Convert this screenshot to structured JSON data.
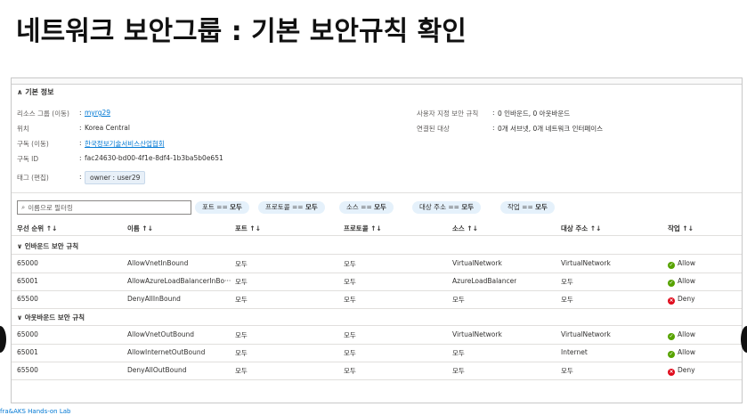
{
  "slide": {
    "title": "네트워크 보안그룹 : 기본 보안규칙 확인",
    "footer": "fra&AKS Hands-on Lab"
  },
  "essentials": {
    "header": "∧ 기본 정보",
    "resource_group_label": "리소스 그룹 (이동)",
    "resource_group_value": "myrg29",
    "location_label": "위치",
    "location_value": "Korea Central",
    "subscription_label": "구독 (이동)",
    "subscription_value": "한국정보기술서비스산업협회",
    "subscription_id_label": "구독 ID",
    "subscription_id_value": "fac24630-bd00-4f1e-8df4-1b3ba5b0e651",
    "tags_label": "태그 (편집)",
    "tag_value": "owner : user29",
    "custom_rules_label": "사용자 지정 보안 규칙",
    "custom_rules_value": "0 인바운드, 0 아웃바운드",
    "associated_label": "연결된 대상",
    "associated_value": "0개 서브넷, 0개 네트워크 인터페이스"
  },
  "filter": {
    "placeholder": "이름으로 필터링",
    "pills": [
      {
        "label": "포트 == ",
        "value": "모두"
      },
      {
        "label": "프로토콜 == ",
        "value": "모두"
      },
      {
        "label": "소스 == ",
        "value": "모두"
      },
      {
        "label": "대상 주소 == ",
        "value": "모두"
      },
      {
        "label": "작업 == ",
        "value": "모두"
      }
    ]
  },
  "table": {
    "columns": [
      "우선 순위 ↑↓",
      "이름 ↑↓",
      "포트 ↑↓",
      "프로토콜 ↑↓",
      "소스 ↑↓",
      "대상 주소 ↑↓",
      "작업 ↑↓"
    ],
    "inbound_group": "∨  인바운드 보안 규칙",
    "outbound_group": "∨  아웃바운드 보안 규칙",
    "inbound": [
      {
        "priority": "65000",
        "name": "AllowVnetInBound",
        "port": "모두",
        "protocol": "모두",
        "source": "VirtualNetwork",
        "dest": "VirtualNetwork",
        "action": "Allow"
      },
      {
        "priority": "65001",
        "name": "AllowAzureLoadBalancerInBo···",
        "port": "모두",
        "protocol": "모두",
        "source": "AzureLoadBalancer",
        "dest": "모두",
        "action": "Allow"
      },
      {
        "priority": "65500",
        "name": "DenyAllInBound",
        "port": "모두",
        "protocol": "모두",
        "source": "모두",
        "dest": "모두",
        "action": "Deny"
      }
    ],
    "outbound": [
      {
        "priority": "65000",
        "name": "AllowVnetOutBound",
        "port": "모두",
        "protocol": "모두",
        "source": "VirtualNetwork",
        "dest": "VirtualNetwork",
        "action": "Allow"
      },
      {
        "priority": "65001",
        "name": "AllowInternetOutBound",
        "port": "모두",
        "protocol": "모두",
        "source": "모두",
        "dest": "Internet",
        "action": "Allow"
      },
      {
        "priority": "65500",
        "name": "DenyAllOutBound",
        "port": "모두",
        "protocol": "모두",
        "source": "모두",
        "dest": "모두",
        "action": "Deny"
      }
    ]
  },
  "colors": {
    "allow": "#57a300",
    "deny": "#e00b1c",
    "link": "#0078d4"
  }
}
